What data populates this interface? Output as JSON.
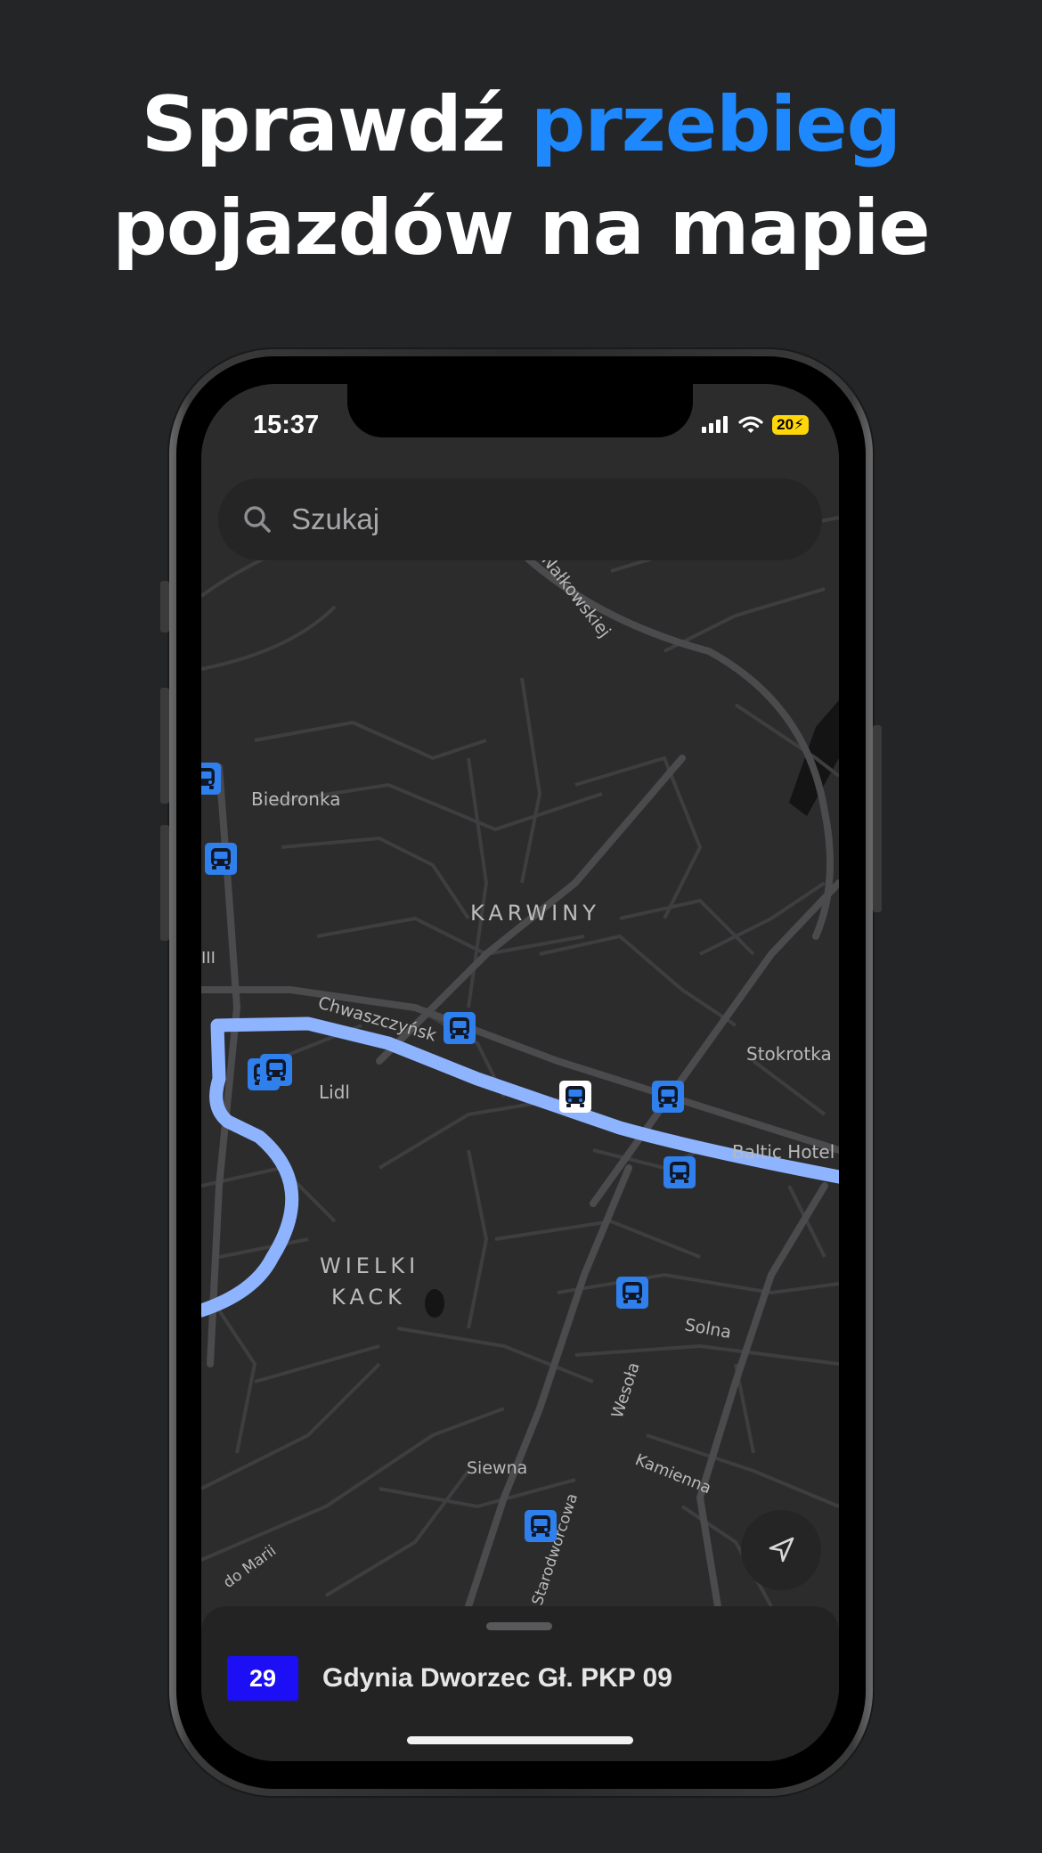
{
  "headline": {
    "part1": "Sprawdź ",
    "part2_accent": "przebieg",
    "line2": "pojazdów na mapie",
    "accent_color": "#1e88ff"
  },
  "status_bar": {
    "time": "15:37",
    "battery": "20",
    "icons": [
      "cellular-signal-icon",
      "wifi-icon",
      "battery-charging-icon"
    ]
  },
  "search": {
    "placeholder": "Szukaj",
    "icon": "search-icon"
  },
  "map": {
    "street_labels": {
      "zofii": "Zofii Nałkowskiej",
      "chwaszczynska": "Chwaszczyńsk",
      "solna": "Solna",
      "wesola": "Wesoła",
      "kamienna": "Kamienna",
      "siewna": "Siewna",
      "starodworcowa": "Starodworcowa",
      "marii": "do Marii",
      "edge_fragment": "III"
    },
    "poi_labels": {
      "biedronka": "Biedronka",
      "lidl": "Lidl",
      "stokrotka": "Stokrotka",
      "baltic_hotel": "Baltic Hotel"
    },
    "district_labels": {
      "karwiny": "KARWINY",
      "wielki": "WIELKI",
      "kack": "KACK"
    },
    "route_color": "#8fb4ff",
    "stop_color": "#2f80ed",
    "selected_stop_color": "#ffffff",
    "stop_icon": "bus-icon",
    "locate_icon": "navigation-arrow-icon"
  },
  "bottom_sheet": {
    "route_number": "29",
    "route_badge_color": "#1d0ff5",
    "destination": "Gdynia Dworzec Gł. PKP 09"
  }
}
